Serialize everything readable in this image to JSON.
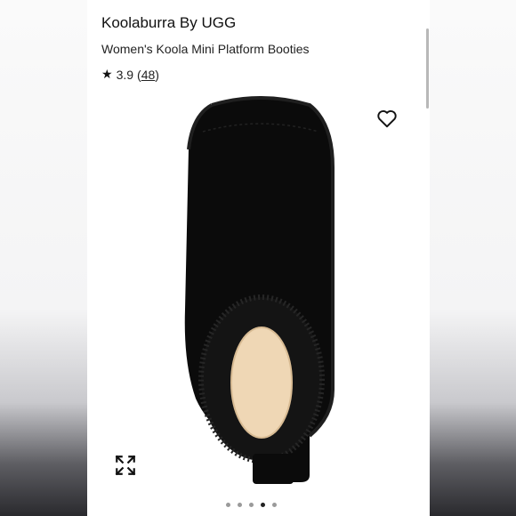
{
  "product": {
    "brand": "Koolaburra By UGG",
    "name": "Women's Koola Mini Platform Booties",
    "rating": "3.9",
    "review_count": "48"
  },
  "icons": {
    "star": "star-icon",
    "heart": "heart-icon",
    "expand": "expand-icon"
  },
  "carousel": {
    "total": 5,
    "active_index": 3
  },
  "colors": {
    "boot": "#0b0b0b",
    "lining": "#efd7b5",
    "dot_active": "#222222",
    "dot_inactive": "#9a9a9a"
  }
}
